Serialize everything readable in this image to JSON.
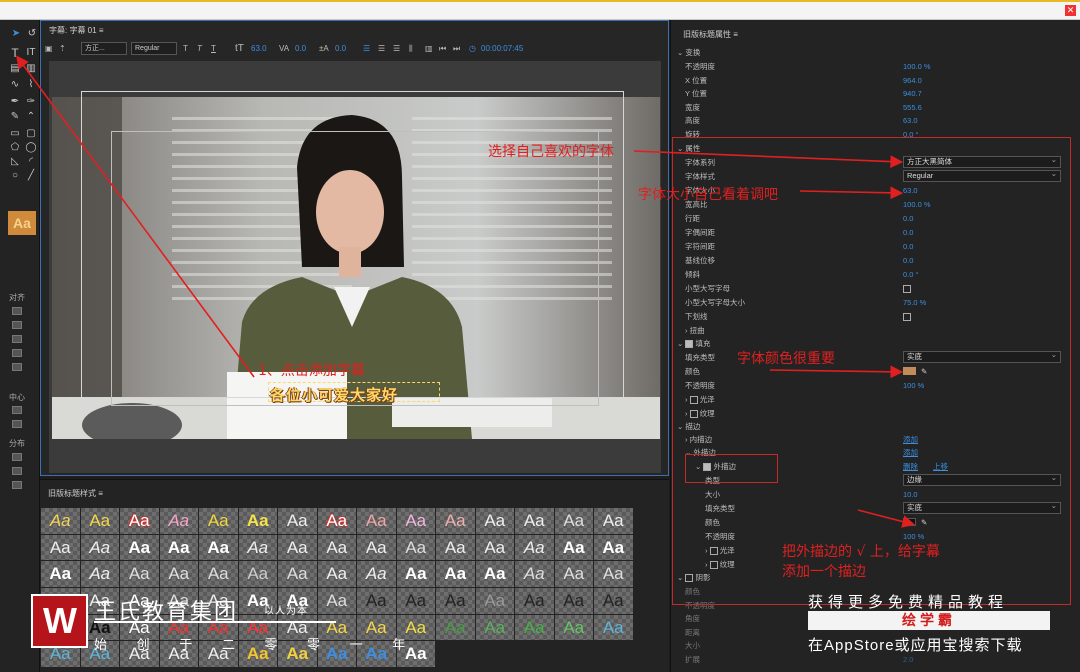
{
  "editor": {
    "title": "字幕: 字幕 01",
    "font_family": "方正...",
    "font_style": "Regular",
    "font_size": "63.0",
    "kerning": "0.0",
    "leading": "0.0",
    "timecode": "00:00:07:45"
  },
  "toolbox": {
    "align_label": "对齐",
    "center_label": "中心",
    "distribute_label": "分布",
    "swatch_text": "Aa"
  },
  "canvas": {
    "caption": "各位小可爱大家好"
  },
  "styles": {
    "title": "旧版标题样式",
    "swatch_text": "Aa"
  },
  "panel": {
    "title": "旧版标题属性",
    "sections": {
      "transform": "变换",
      "properties": "属性",
      "fill": "填充",
      "stroke": "描边",
      "shadow": "阴影"
    },
    "transform": [
      {
        "label": "不透明度",
        "value": "100.0 %"
      },
      {
        "label": "X 位置",
        "value": "964.0"
      },
      {
        "label": "Y 位置",
        "value": "940.7"
      },
      {
        "label": "宽度",
        "value": "555.6"
      },
      {
        "label": "高度",
        "value": "63.0"
      },
      {
        "label": "旋转",
        "value": "0.0 °"
      }
    ],
    "font_family_label": "字体系列",
    "font_family_value": "方正大黑简体",
    "font_style_label": "字体样式",
    "font_style_value": "Regular",
    "properties": [
      {
        "label": "字体大小",
        "value": "63.0"
      },
      {
        "label": "宽高比",
        "value": "100.0 %"
      },
      {
        "label": "行距",
        "value": "0.0"
      },
      {
        "label": "字偶间距",
        "value": "0.0"
      },
      {
        "label": "字符间距",
        "value": "0.0"
      },
      {
        "label": "基线位移",
        "value": "0.0"
      },
      {
        "label": "倾斜",
        "value": "0.0 °"
      }
    ],
    "small_caps": "小型大写字母",
    "small_caps_size_label": "小型大写字母大小",
    "small_caps_size": "75.0 %",
    "underline": "下划线",
    "distort": "扭曲",
    "fill_type_label": "填充类型",
    "fill_type": "实底",
    "color_label": "颜色",
    "opacity_label": "不透明度",
    "fill_opacity": "100 %",
    "sheen": "光泽",
    "texture": "纹理",
    "inner_stroke": "内描边",
    "outer_stroke": "外描边",
    "add": "添加",
    "delete": "删除",
    "move_up": "上移",
    "stroke_type_label": "类型",
    "stroke_type": "边缘",
    "size_label": "大小",
    "stroke_size": "10.0",
    "stroke_fill_type": "实底",
    "stroke_opacity": "100 %",
    "shadow_rows": [
      "颜色",
      "不透明度",
      "角度",
      "距离",
      "大小",
      "扩展"
    ],
    "shadow_values": [
      "",
      "",
      "",
      "",
      "",
      "2.0"
    ],
    "fill_color": "#c08d5a",
    "stroke_color": "#111111"
  },
  "annotations": {
    "step1": "1、点击添加字幕",
    "choose_font": "选择自己喜欢的字体",
    "font_size": "字体大小自己看着调吧",
    "font_color": "字体颜色很重要",
    "stroke": "把外描边的 √ 上，给字幕",
    "stroke2": "添加一个描边"
  },
  "brand": {
    "name": "王氏教育集团",
    "slogan": "以人为本",
    "sub": "始 创 于 二 零 零 一 年"
  },
  "promo": {
    "line1": "获得更多免费精品教程",
    "app": "绘学霸",
    "line3": "在AppStore或应用宝搜索下载"
  },
  "colors": {
    "accent": "#3b8fe0",
    "annotation": "#e02020",
    "caption": "#ffd86a",
    "brand_red": "#b5151a"
  }
}
